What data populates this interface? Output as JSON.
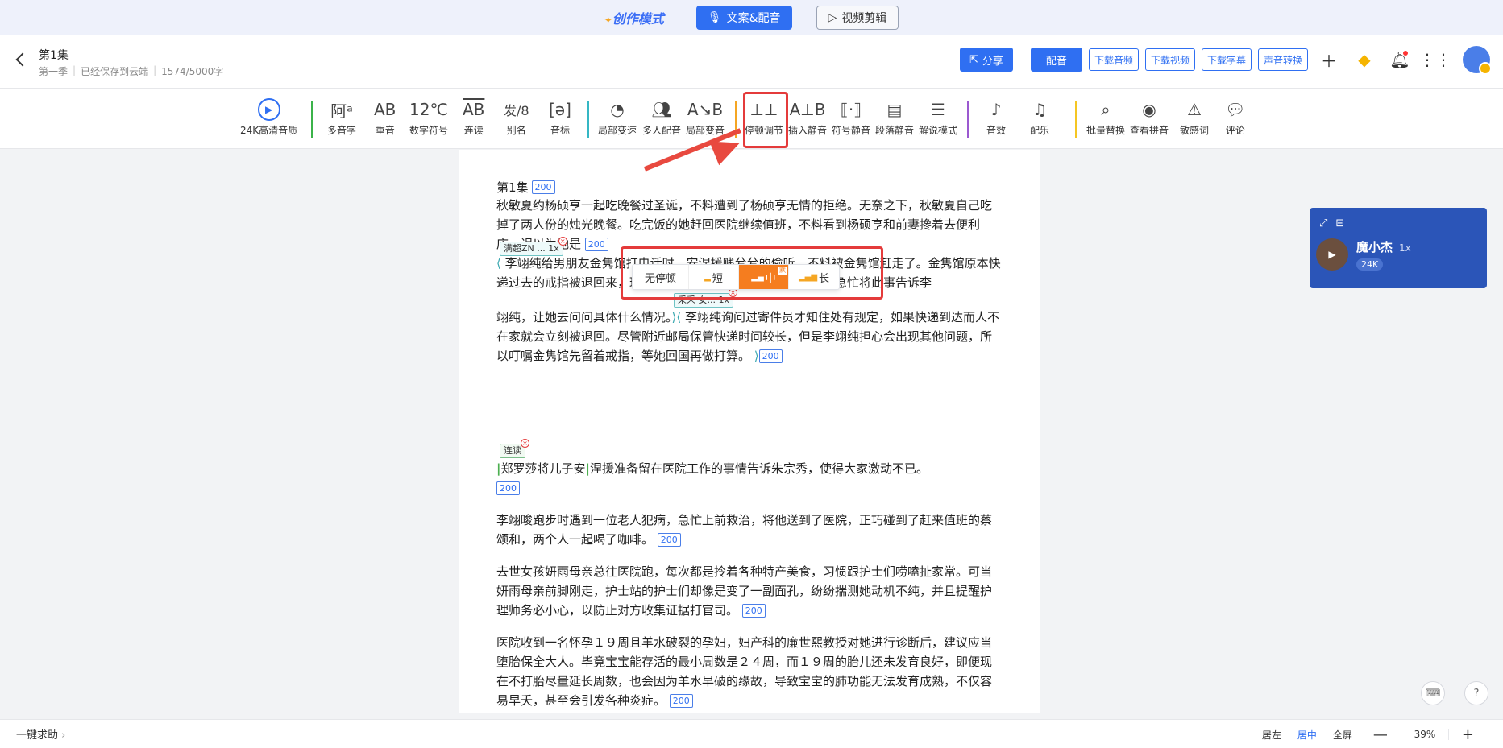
{
  "modebar": {
    "title": "创作模式",
    "btn_active": "文案&配音",
    "btn_video": "视频剪辑"
  },
  "header": {
    "title": "第1集",
    "season": "第一季",
    "saved": "已经保存到云端",
    "count": "1574/5000字",
    "share": "分享",
    "dub": "配音",
    "dl_audio": "下载音频",
    "dl_video": "下载视频",
    "dl_sub": "下载字幕",
    "voice_convert": "声音转换"
  },
  "toolbar": {
    "hd": "24K高清音质",
    "t1": "多音字",
    "t2": "重音",
    "t3": "数字符号",
    "t4": "连读",
    "t5": "别名",
    "t6": "音标",
    "t7": "局部变速",
    "t8": "多人配音",
    "t9": "局部变音",
    "t10": "停顿调节",
    "t11": "插入静音",
    "t12": "符号静音",
    "t13": "段落静音",
    "t14": "解说模式",
    "t15": "音效",
    "t16": "配乐",
    "t17": "批量替换",
    "t18": "查看拼音",
    "t19": "敏感词",
    "t20": "评论",
    "i2": "AB",
    "i3": "12℃",
    "i4": "AB",
    "i5": "发/8"
  },
  "editor": {
    "ep_title": "第1集",
    "ep_badge": "200",
    "p1": "秋敏夏约杨硕亨一起吃晚餐过圣诞，不料遭到了杨硕亨无情的拒绝。无奈之下，秋敏夏自己吃掉了两人份的烛光晚餐。吃完饭的她赶回医院继续值班，不料看到杨硕亨和前妻搀着去便利店，误以为她是",
    "p1_badge": "200",
    "tag1": "满超ZN ... 1x",
    "p2a": "李翊纯给男朋友金隽馆打电话时，安涅援贱兮兮的偷听，不料被金隽馆赶走了。金隽馆原本快递过去的戒指被退回来，理由是收件人不明，心中很是疑惑。他急忙将此事告诉李",
    "tag2": "采采 女... 1x",
    "p2b": "翊纯，让她去问问具体什么情况。",
    "p2c": "李翊纯询问过寄件员才知住处有规定，如果快递到达而人不在家就会立刻被退回。尽管附近邮局保管快递时间较长，但是李翊纯担心会出现其他问题，所以叮嘱金隽馆先留着戒指，等她回国再做打算。",
    "p2_badge": "200",
    "tag3": "连读",
    "p3a": "郑罗莎将儿子安",
    "p3b": "涅援准备留在医院工作的事情告诉朱宗秀，使得大家激动不已。",
    "p3_badge": "200",
    "p4": "李翊晙跑步时遇到一位老人犯病，急忙上前救治，将他送到了医院，正巧碰到了赶来值班的蔡颂和，两个人一起喝了咖啡。",
    "p4_badge": "200",
    "p5": "去世女孩妍雨母亲总往医院跑，每次都是拎着各种特产美食，习惯跟护士们唠嗑扯家常。可当妍雨母亲前脚刚走，护士站的护士们却像是变了一副面孔，纷纷揣测她动机不纯，并且提醒护理师务必小心，以防止对方收集证据打官司。",
    "p5_badge": "200",
    "p6": "医院收到一名怀孕１９周且羊水破裂的孕妇，妇产科的廉世熙教授对她进行诊断后，建议应当堕胎保全大人。毕竟宝宝能存活的最小周数是２４周，而１９周的胎儿还未发育良好，即便现在不打胎尽量延长周数，也会因为羊水早破的缘故，导致宝宝的肺功能无法发育成熟，不仅容易早夭，甚至会引发各种炎症。",
    "p6_badge": "200"
  },
  "pause_popup": {
    "none": "无停顿",
    "short": "短",
    "mid": "中",
    "mid_tag": "默",
    "long": "长"
  },
  "voice_card": {
    "name": "魔小杰",
    "speed": "1x",
    "quality": "24K"
  },
  "bottombar": {
    "help": "一键求助",
    "left": "居左",
    "center": "居中",
    "full": "全屏",
    "minus": "—",
    "zoom": "39%",
    "plus": "+"
  },
  "colors": {
    "accent": "#2f6ff2",
    "highlight": "#e43b3b",
    "orange": "#f57d1f",
    "voice_card": "#2b55b8"
  }
}
